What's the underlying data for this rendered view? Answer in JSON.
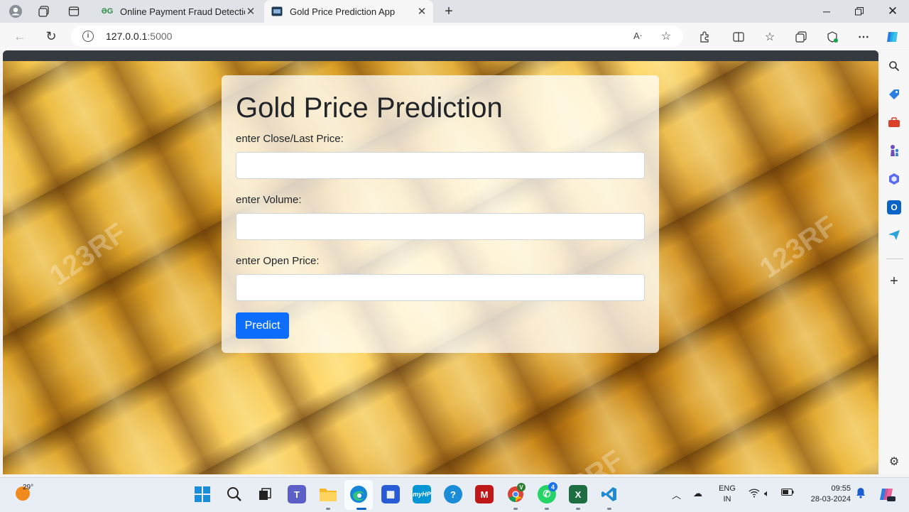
{
  "browser": {
    "tabs": [
      {
        "title": "Online Payment Fraud Detection",
        "favicon": "geeksforgeeks-icon",
        "active": false
      },
      {
        "title": "Gold Price Prediction App",
        "favicon": "app-icon",
        "active": true
      }
    ],
    "address": {
      "host": "127.0.0.1",
      "port": ":5000"
    }
  },
  "page": {
    "title": "Gold Price Prediction",
    "fields": [
      {
        "label": "enter Close/Last Price:",
        "value": "",
        "placeholder": ""
      },
      {
        "label": "enter Volume:",
        "value": "",
        "placeholder": ""
      },
      {
        "label": "enter Open Price:",
        "value": "",
        "placeholder": ""
      }
    ],
    "submit_label": "Predict",
    "background": "gold-bars-image",
    "watermark": "123RF"
  },
  "sidebar": {
    "icons": [
      "search-icon",
      "tag-icon",
      "toolbox-icon",
      "chess-icon",
      "copilot-hex-icon",
      "outlook-icon",
      "send-icon",
      "add-icon",
      "settings-icon"
    ]
  },
  "taskbar": {
    "weather_temp": "29°",
    "lang_line1": "ENG",
    "lang_line2": "IN",
    "time": "09:55",
    "date": "28-03-2024",
    "whatsapp_badge": "4",
    "chrome_badge": "V",
    "hp_label": "myHP",
    "excel_label": "X"
  },
  "colors": {
    "primary_button": "#0d6efd",
    "navbar": "#343a40"
  }
}
